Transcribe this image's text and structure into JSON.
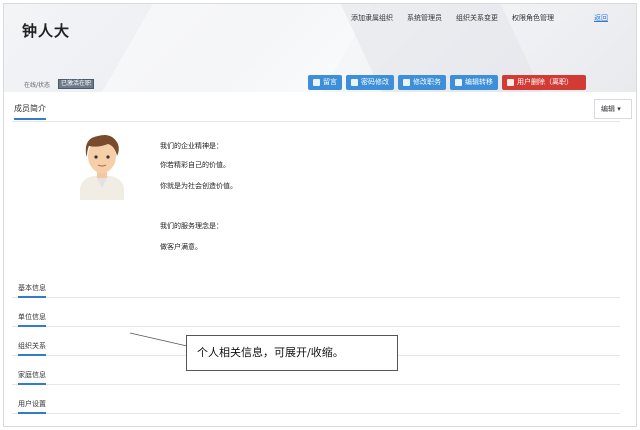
{
  "header": {
    "title": "钟人大",
    "links": [
      "添加隶属组织",
      "系统管理员",
      "组织关系变更",
      "权限角色管理"
    ],
    "back_link": "返回",
    "status_label": "在线/状态",
    "status_badge": "已激活在职"
  },
  "actions": [
    {
      "label": "留言",
      "icon": "chat-icon"
    },
    {
      "label": "密码修改",
      "icon": "lock-icon"
    },
    {
      "label": "修改职务",
      "icon": "edit-icon"
    },
    {
      "label": "编辑转移",
      "icon": "transfer-icon"
    },
    {
      "label": "用户删除（离职）",
      "icon": "delete-icon"
    }
  ],
  "colors": {
    "primary": "#3c8fd8",
    "danger": "#d23b34",
    "accent": "#2f7bd6"
  },
  "profile": {
    "tab": "成员简介",
    "dropdown": "编辑 ▾",
    "lines": [
      "我们的企业精神是：",
      "你若精彩自己的价值。",
      "你就是为社会创造价值。",
      "我们的服务理念是：",
      "做客户满意。"
    ]
  },
  "sections": [
    "基本信息",
    "单位信息",
    "组织关系",
    "家庭信息",
    "用户设置"
  ],
  "callout": "个人相关信息，可展开/收缩。"
}
